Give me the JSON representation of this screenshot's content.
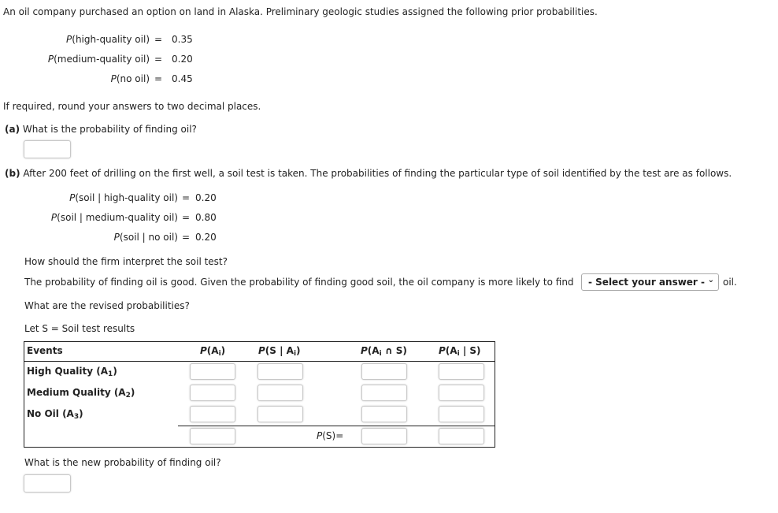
{
  "intro": "An oil company purchased an option on land in Alaska. Preliminary geologic studies assigned the following prior probabilities.",
  "priors": [
    {
      "label": "(high-quality oil)",
      "value": "0.35"
    },
    {
      "label": "(medium-quality oil)",
      "value": "0.20"
    },
    {
      "label": "(no oil)",
      "value": "0.45"
    }
  ],
  "p_symbol": "P",
  "equals": "=",
  "rounding_note": "If required, round your answers to two decimal places.",
  "part_a": {
    "tag": "(a)",
    "question": "What is the probability of finding oil?",
    "answer": ""
  },
  "part_b": {
    "tag": "(b)",
    "intro": "After 200 feet of drilling on the first well, a soil test is taken. The probabilities of finding the particular type of soil identified by the test are as follows.",
    "conditionals": [
      {
        "label": "(soil | high-quality oil)",
        "value": "0.20"
      },
      {
        "label": "(soil | medium-quality oil)",
        "value": "0.80"
      },
      {
        "label": "(soil | no oil)",
        "value": "0.20"
      }
    ],
    "interpret_question": "How should the firm interpret the soil test?",
    "interpret_sentence_before": "The probability of finding oil is good. Given the probability of finding good soil, the oil company is more likely to find",
    "interpret_select": "- Select your answer -",
    "interpret_sentence_after": "oil.",
    "revised_question": "What are the revised probabilities?",
    "let_s": "Let S = Soil test results",
    "table": {
      "headers": [
        "Events",
        "P(A",
        "P(S | A",
        "P(A",
        "P(A"
      ],
      "header_suffix": [
        "",
        ")",
        ")",
        " ∩ S)",
        " | S)"
      ],
      "rows": [
        {
          "event": "High Quality (A",
          "sub": "1"
        },
        {
          "event": "Medium Quality (A",
          "sub": "2"
        },
        {
          "event": "No Oil (A",
          "sub": "3"
        }
      ],
      "ps_label": "(S)="
    },
    "new_prob_question": "What is the new probability of finding oil?",
    "new_prob_answer": ""
  }
}
